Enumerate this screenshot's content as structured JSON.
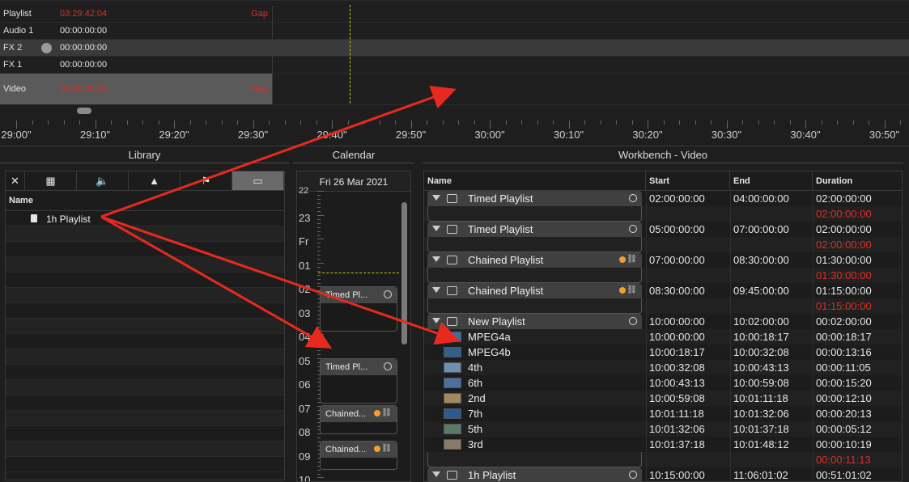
{
  "timeline": {
    "tracks": [
      {
        "name": "Playlist",
        "timecode": "03:29:42:04",
        "timecode_red": true,
        "gap": "Gap"
      },
      {
        "name": "Audio 1",
        "timecode": "00:00:00:00",
        "timecode_red": false,
        "gap": ""
      },
      {
        "name": "FX 2",
        "timecode": "00:00:00:00",
        "timecode_red": false,
        "gap": ""
      },
      {
        "name": "FX 1",
        "timecode": "00:00:00:00",
        "timecode_red": false,
        "gap": ""
      },
      {
        "name": "Video",
        "timecode": "00:00:00:00",
        "timecode_red": true,
        "gap": "Gap"
      }
    ],
    "ruler": [
      "29:00\"",
      "29:10\"",
      "29:20\"",
      "29:30\"",
      "29:40\"",
      "29:50\"",
      "30:00\"",
      "30:10\"",
      "30:20\"",
      "30:30\"",
      "30:40\"",
      "30:50\""
    ]
  },
  "library": {
    "title": "Library",
    "tabs": [
      {
        "icon": "close-icon",
        "glyph": "✕"
      },
      {
        "icon": "film-icon",
        "glyph": "▦"
      },
      {
        "icon": "speaker-icon",
        "glyph": "🔈"
      },
      {
        "icon": "mountain-icon",
        "glyph": "▲"
      },
      {
        "icon": "flag-icon",
        "glyph": "⚑"
      },
      {
        "icon": "window-icon",
        "glyph": "▭"
      }
    ],
    "column": "Name",
    "item": "1h Playlist"
  },
  "calendar": {
    "title": "Calendar",
    "date": "Fri 26 Mar 2021",
    "hours": [
      "22",
      "23",
      "Fr",
      "01",
      "02",
      "03",
      "04",
      "05",
      "06",
      "07",
      "08",
      "09",
      "10"
    ],
    "events": [
      {
        "label": "Timed Pl...",
        "kind": "timed"
      },
      {
        "label": "Timed Pl...",
        "kind": "timed"
      },
      {
        "label": "Chained...",
        "kind": "chained"
      },
      {
        "label": "Chained...",
        "kind": "chained"
      }
    ]
  },
  "workbench": {
    "title": "Workbench - Video",
    "columns": {
      "name": "Name",
      "start": "Start",
      "end": "End",
      "duration": "Duration"
    },
    "rows": [
      {
        "type": "group",
        "name": "Timed Playlist",
        "icon": "clock",
        "start": "02:00:00:00",
        "end": "04:00:00:00",
        "duration": "02:00:00:00"
      },
      {
        "type": "remain",
        "duration": "02:00:00:00"
      },
      {
        "type": "group",
        "name": "Timed Playlist",
        "icon": "clock",
        "start": "05:00:00:00",
        "end": "07:00:00:00",
        "duration": "02:00:00:00"
      },
      {
        "type": "remain",
        "duration": "02:00:00:00"
      },
      {
        "type": "group",
        "name": "Chained Playlist",
        "icon": "chain",
        "start": "07:00:00:00",
        "end": "08:30:00:00",
        "duration": "01:30:00:00"
      },
      {
        "type": "remain",
        "duration": "01:30:00:00"
      },
      {
        "type": "group",
        "name": "Chained Playlist",
        "icon": "chain",
        "start": "08:30:00:00",
        "end": "09:45:00:00",
        "duration": "01:15:00:00"
      },
      {
        "type": "remain",
        "duration": "01:15:00:00"
      },
      {
        "type": "group",
        "name": "New Playlist",
        "icon": "clock",
        "start": "10:00:00:00",
        "end": "10:02:00:00",
        "duration": "00:02:00:00"
      },
      {
        "type": "item",
        "name": "MPEG4a",
        "color": "#3a6ea8",
        "start": "10:00:00:00",
        "end": "10:00:18:17",
        "duration": "00:00:18:17"
      },
      {
        "type": "item",
        "name": "MPEG4b",
        "color": "#2f5f8a",
        "start": "10:00:18:17",
        "end": "10:00:32:08",
        "duration": "00:00:13:16"
      },
      {
        "type": "item",
        "name": "4th",
        "color": "#6b8fb5",
        "start": "10:00:32:08",
        "end": "10:00:43:13",
        "duration": "00:00:11:05"
      },
      {
        "type": "item",
        "name": "6th",
        "color": "#4a6fa0",
        "start": "10:00:43:13",
        "end": "10:00:59:08",
        "duration": "00:00:15:20"
      },
      {
        "type": "item",
        "name": "2nd",
        "color": "#a08a60",
        "start": "10:00:59:08",
        "end": "10:01:11:18",
        "duration": "00:00:12:10"
      },
      {
        "type": "item",
        "name": "7th",
        "color": "#2c5a90",
        "start": "10:01:11:18",
        "end": "10:01:32:06",
        "duration": "00:00:20:13"
      },
      {
        "type": "item",
        "name": "5th",
        "color": "#5a7a6a",
        "start": "10:01:32:06",
        "end": "10:01:37:18",
        "duration": "00:00:05:12"
      },
      {
        "type": "item",
        "name": "3rd",
        "color": "#8a7a6a",
        "start": "10:01:37:18",
        "end": "10:01:48:12",
        "duration": "00:00:10:19"
      },
      {
        "type": "remain",
        "duration": "00:00:11:13"
      },
      {
        "type": "group",
        "name": "1h Playlist",
        "icon": "clock",
        "start": "10:15:00:00",
        "end": "11:06:01:02",
        "duration": "00:51:01:02"
      }
    ]
  },
  "colors": {
    "accent_red": "#d9302a",
    "arrow": "#e8291f",
    "orange": "#f0a030",
    "playhead": "#c8c800"
  }
}
